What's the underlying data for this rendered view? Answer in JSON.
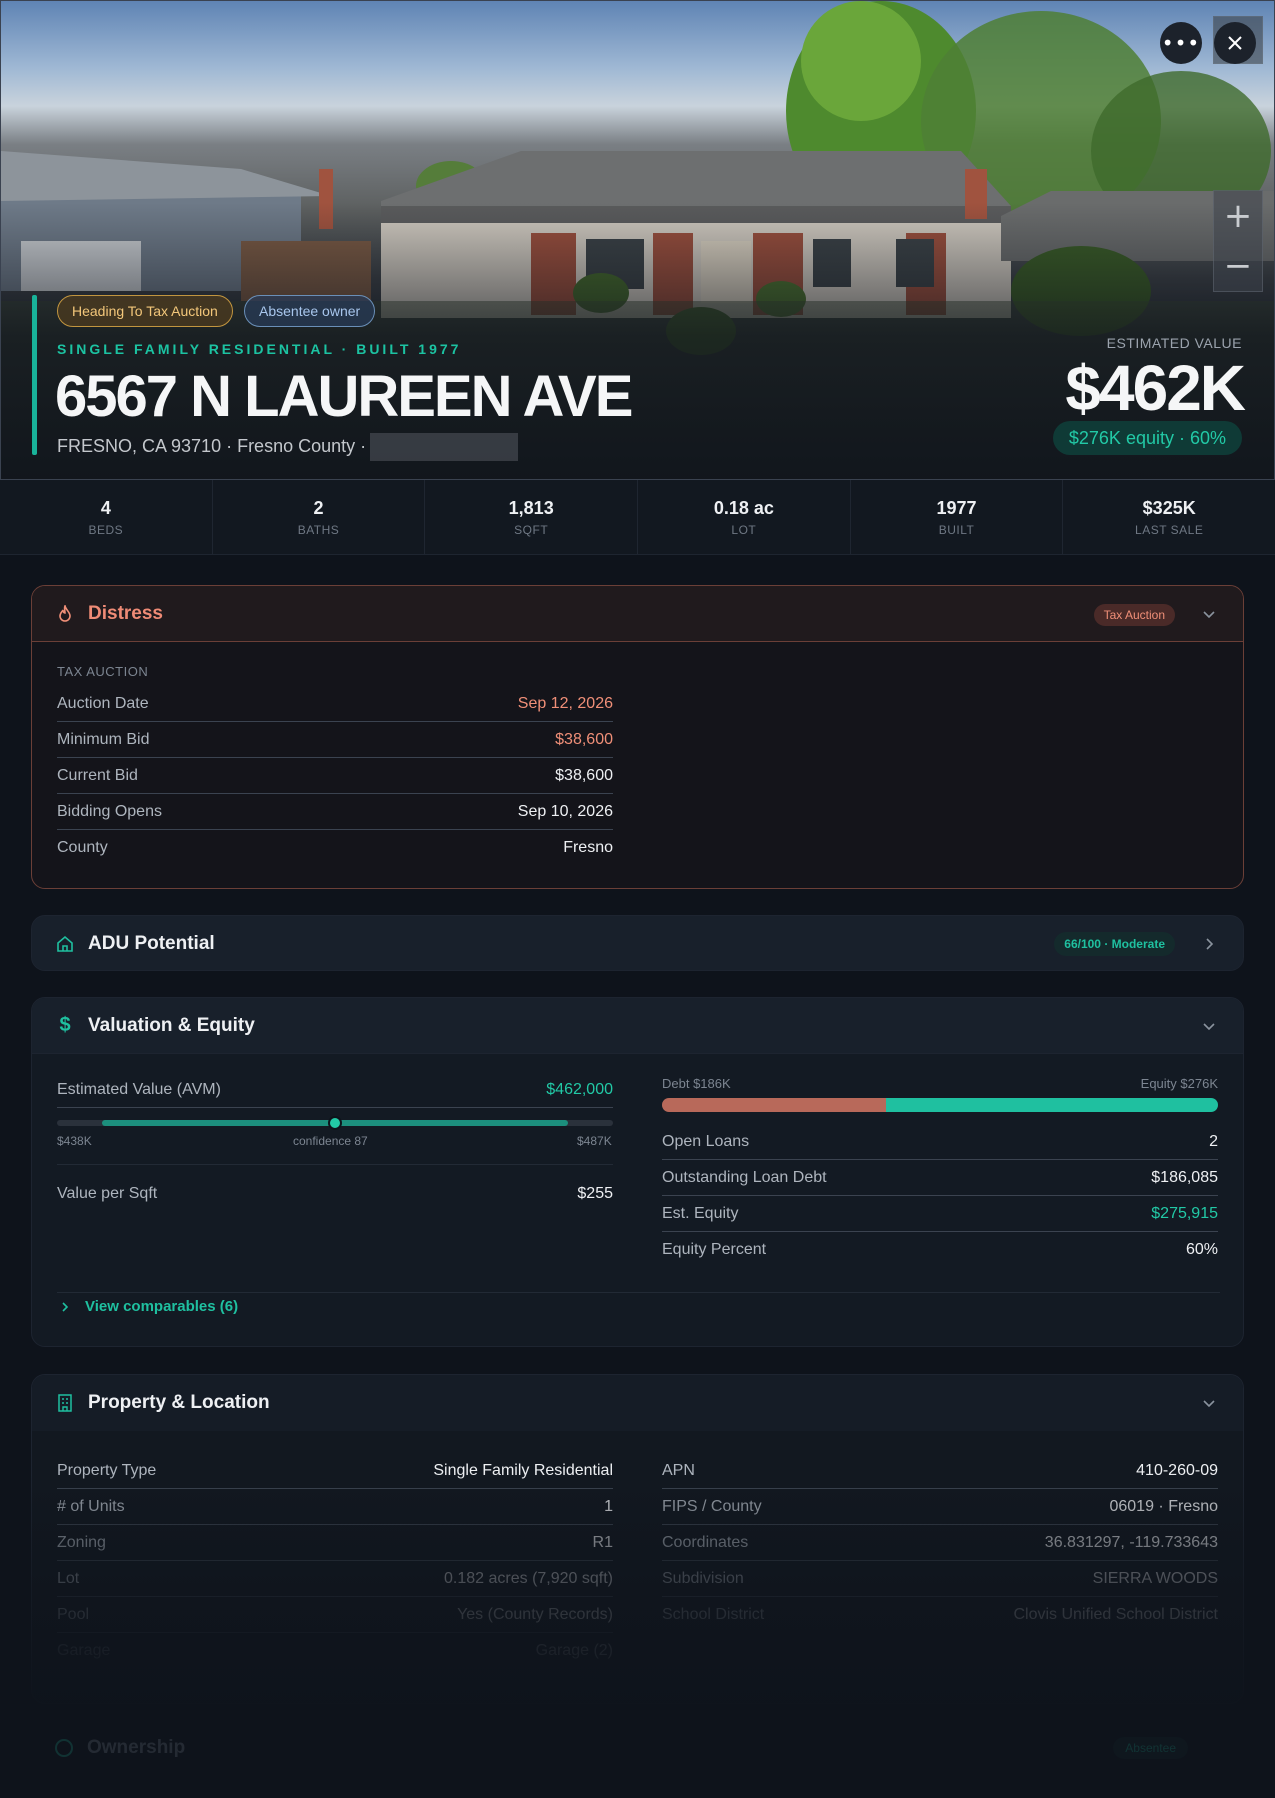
{
  "header": {
    "tags": [
      "Heading To Tax Auction",
      "Absentee owner"
    ],
    "subtitle": "SINGLE FAMILY RESIDENTIAL · BUILT 1977",
    "address": "6567 N LAUREEN AVE",
    "city_line": "FRESNO, CA 93710 · Fresno County ·",
    "estimated_value_label": "ESTIMATED VALUE",
    "estimated_value": "$462K",
    "equity_summary": "$276K equity · 60%",
    "more_icon": "more-horizontal-icon",
    "close_icon": "close-icon",
    "zoom_in": "+",
    "zoom_out": "−"
  },
  "stats": [
    {
      "value": "4",
      "label": "BEDS"
    },
    {
      "value": "2",
      "label": "BATHS"
    },
    {
      "value": "1,813",
      "label": "SQFT"
    },
    {
      "value": "0.18 ac",
      "label": "LOT"
    },
    {
      "value": "1977",
      "label": "BUILT"
    },
    {
      "value": "$325K",
      "label": "LAST SALE"
    }
  ],
  "distress": {
    "title": "Distress",
    "badge": "Tax Auction",
    "section_label": "TAX AUCTION",
    "rows": [
      {
        "key": "Auction Date",
        "value": "Sep 12, 2026"
      },
      {
        "key": "Minimum Bid",
        "value": "$38,600"
      },
      {
        "key": "Current Bid",
        "value": "$38,600"
      },
      {
        "key": "Bidding Opens",
        "value": "Sep 10, 2026"
      },
      {
        "key": "County",
        "value": "Fresno"
      }
    ]
  },
  "adu": {
    "title": "ADU Potential",
    "badge": "66/100 · Moderate"
  },
  "valuation": {
    "title": "Valuation & Equity",
    "avm_label": "Estimated Value (AVM)",
    "avm_value": "$462,000",
    "range_low": "$438K",
    "confidence": "confidence 87",
    "range_high": "$487K",
    "value_per_sqft_label": "Value per Sqft",
    "value_per_sqft": "$255",
    "debt_label": "Debt $186K",
    "equity_label": "Equity $276K",
    "debt_fraction": 0.403,
    "rows": [
      {
        "key": "Open Loans",
        "value": "2"
      },
      {
        "key": "Outstanding Loan Debt",
        "value": "$186,085"
      },
      {
        "key": "Est. Equity",
        "value": "$275,915"
      },
      {
        "key": "Equity Percent",
        "value": "60%"
      }
    ],
    "comparables_link": "View comparables (6)"
  },
  "property": {
    "title": "Property & Location",
    "left_rows": [
      {
        "key": "Property Type",
        "value": "Single Family Residential"
      },
      {
        "key": "# of Units",
        "value": "1"
      },
      {
        "key": "Zoning",
        "value": "R1"
      },
      {
        "key": "Lot",
        "value": "0.182 acres (7,920 sqft)"
      },
      {
        "key": "Pool",
        "value": "Yes (County Records)"
      },
      {
        "key": "Garage",
        "value": "Garage (2)"
      }
    ],
    "right_rows": [
      {
        "key": "APN",
        "value": "410-260-09"
      },
      {
        "key": "FIPS / County",
        "value": "06019 · Fresno"
      },
      {
        "key": "Coordinates",
        "value": "36.831297, -119.733643"
      },
      {
        "key": "Subdivision",
        "value": "SIERRA WOODS"
      },
      {
        "key": "School District",
        "value": "Clovis Unified School District"
      }
    ]
  },
  "ownership": {
    "title": "Ownership",
    "badge": "Absentee"
  },
  "colors": {
    "accent": "#1fc0a0",
    "distress": "#f08f78",
    "debt": "#b8695a",
    "background": "#0e131b"
  }
}
